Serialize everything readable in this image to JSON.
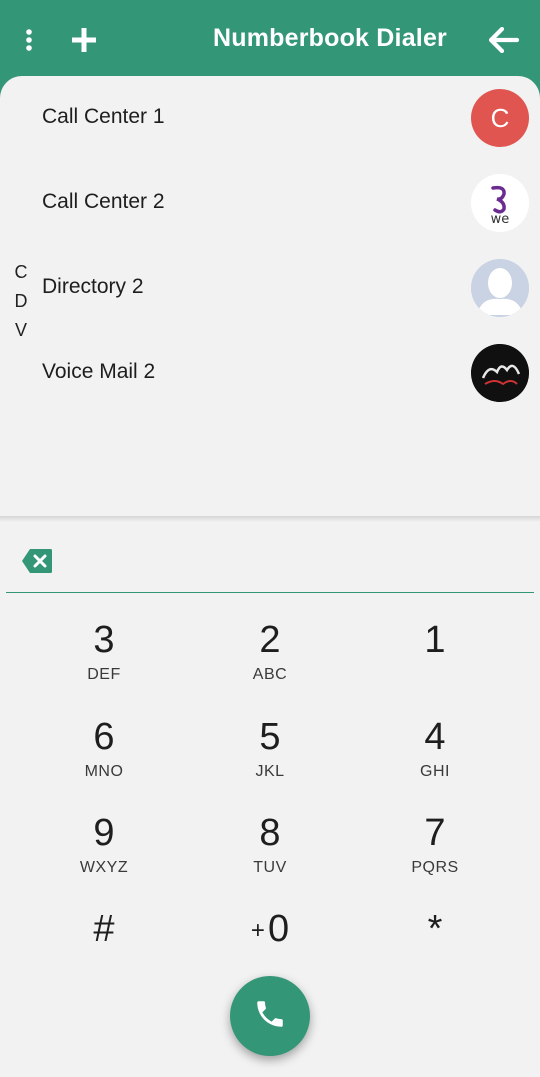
{
  "app": {
    "title": "Numberbook Dialer",
    "accent_color": "#339676",
    "menu_icon": "more-vertical-icon",
    "add_icon": "plus-icon",
    "back_icon": "arrow-back-icon"
  },
  "contacts": [
    {
      "name": "Call Center 1",
      "avatar_letter": "C",
      "avatar_type": "letter"
    },
    {
      "name": "Call Center 2",
      "avatar_type": "we-logo-image"
    },
    {
      "name": "Directory 2",
      "avatar_type": "default-person-image"
    },
    {
      "name": "Voice Mail 2",
      "avatar_type": "photo-image"
    }
  ],
  "alpha_index": [
    "C",
    "D",
    "V"
  ],
  "dialer": {
    "input_value": "",
    "backspace_icon": "backspace-icon",
    "keys": [
      {
        "digit": "3",
        "letters": "DEF"
      },
      {
        "digit": "2",
        "letters": "ABC"
      },
      {
        "digit": "1",
        "letters": ""
      },
      {
        "digit": "6",
        "letters": "MNO"
      },
      {
        "digit": "5",
        "letters": "JKL"
      },
      {
        "digit": "4",
        "letters": "GHI"
      },
      {
        "digit": "9",
        "letters": "WXYZ"
      },
      {
        "digit": "8",
        "letters": "TUV"
      },
      {
        "digit": "7",
        "letters": "PQRS"
      },
      {
        "digit": "#",
        "letters": ""
      },
      {
        "digit": "0",
        "prefix": "+",
        "letters": ""
      },
      {
        "digit": "*",
        "letters": ""
      }
    ],
    "call_icon": "phone-icon"
  }
}
